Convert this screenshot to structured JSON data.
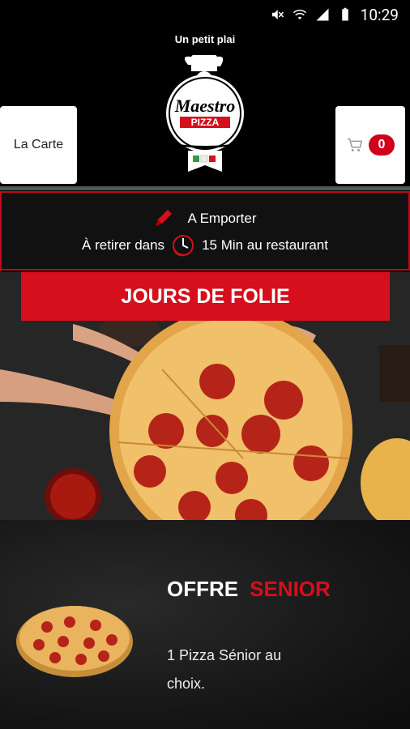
{
  "status_bar": {
    "time": "10:29"
  },
  "header": {
    "title": "Un petit plai",
    "logo_text_main": "Maestro",
    "logo_text_sub": "PIZZA",
    "menu_button": "La Carte",
    "cart_count": "0"
  },
  "order": {
    "mode_label": "A Emporter",
    "pickup_prefix": "À retirer dans",
    "pickup_suffix": "15 Min au restaurant"
  },
  "promo": {
    "banner_label": "JOURS DE FOLIE"
  },
  "offer": {
    "title_word1": "OFFRE",
    "title_word2": "SENIOR",
    "description": "1 Pizza Sénior au choix."
  },
  "colors": {
    "accent": "#d50f1c",
    "background": "#000000",
    "border": "#c4061c"
  }
}
